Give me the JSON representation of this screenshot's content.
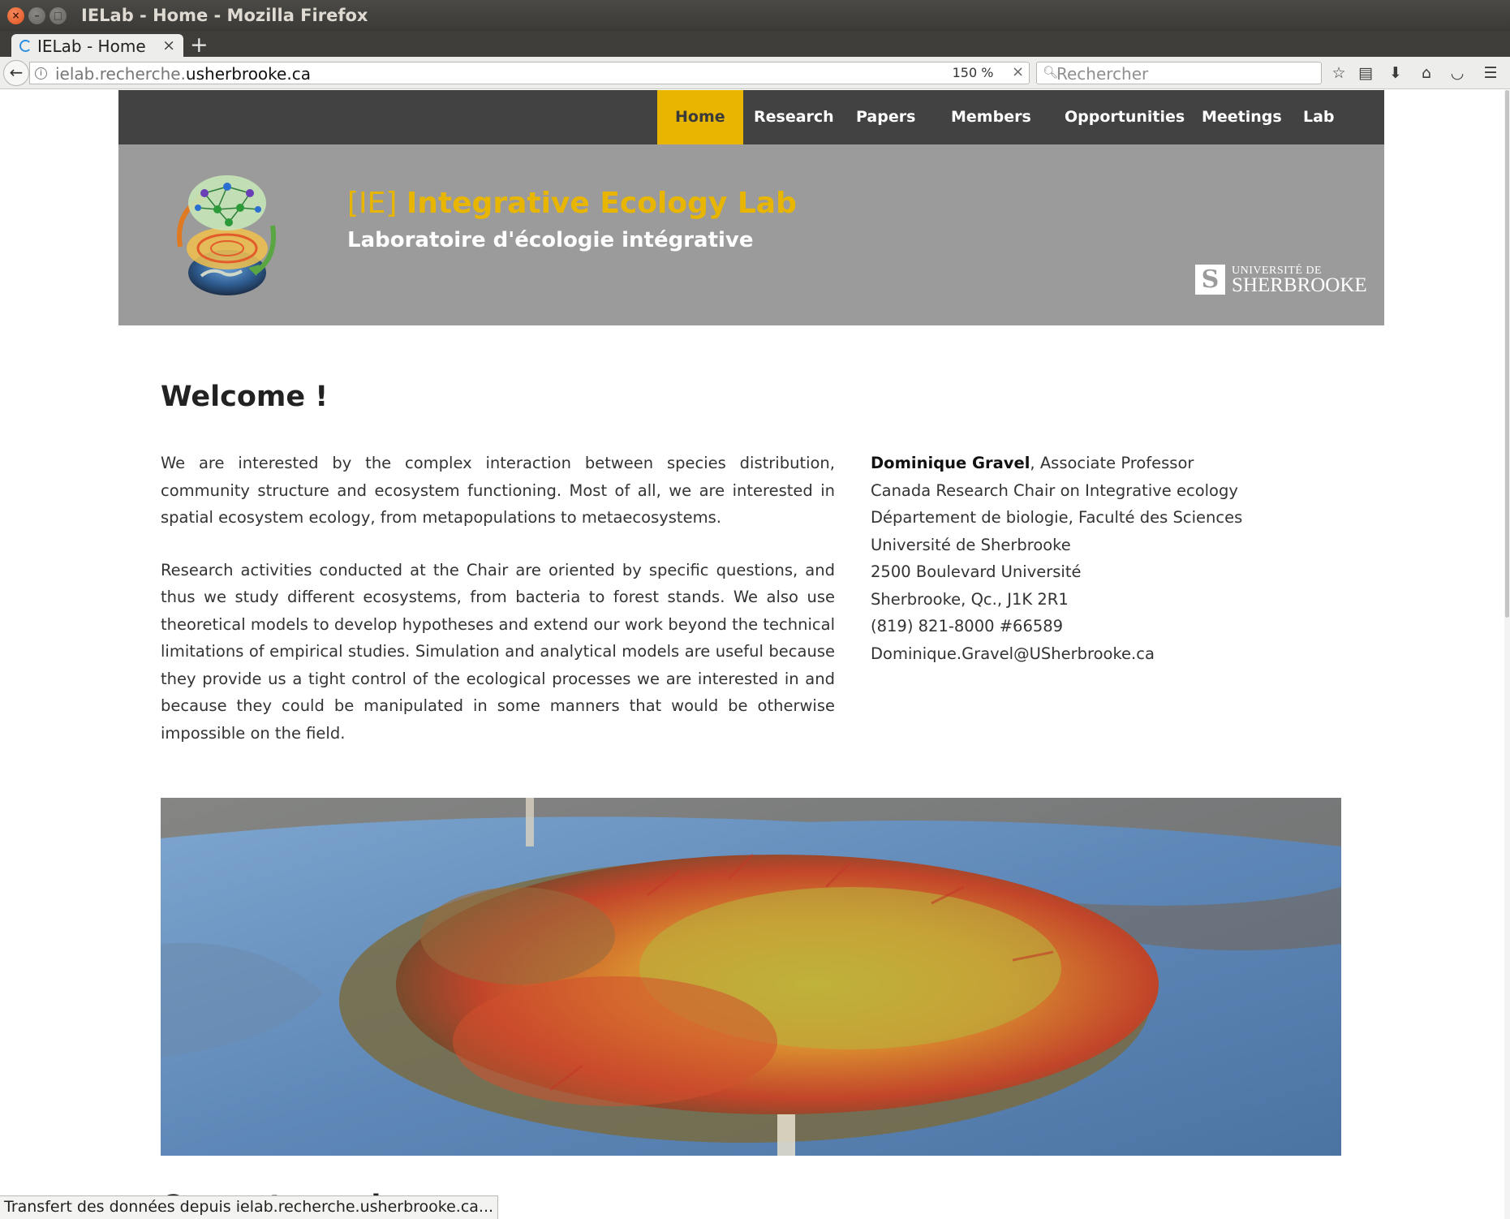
{
  "window": {
    "title": "IELab - Home - Mozilla Firefox"
  },
  "tabs": [
    {
      "label": "IELab - Home",
      "loading": true
    }
  ],
  "navbar": {
    "url_subdomain": "ielab.recherche.",
    "url_domain": "usherbrooke.ca",
    "zoom": "150 %",
    "search_placeholder": "Rechercher"
  },
  "site": {
    "nav": [
      {
        "label": "Home",
        "active": true
      },
      {
        "label": "Research"
      },
      {
        "label": "Papers"
      },
      {
        "label": "Members"
      },
      {
        "label": "Opportunities"
      },
      {
        "label": "Meetings"
      },
      {
        "label": "Lab spaces"
      }
    ],
    "banner": {
      "bracket": "[IE]",
      "name": "Integrative Ecology Lab",
      "subtitle": "Laboratoire d'écologie intégrative",
      "university_top": "UNIVERSITÉ DE",
      "university_main": "SHERBROOKE"
    },
    "welcome": "Welcome !",
    "intro": [
      "We are interested by the complex interaction between species distribution, community structure and ecosystem functioning. Most of all, we are interested in spatial ecosystem ecology, from metapopulations to metaecosystems.",
      "Research activities conducted at the Chair are oriented by specific questions, and thus we study different ecosystems, from bacteria to forest stands. We also use theoretical models to develop hypotheses and extend our work beyond the technical limitations of empirical studies. Simulation and analytical models are useful because they provide us a tight control of the ecological processes we are interested in and because they could be manipulated in some manners that would be otherwise impossible on the field."
    ],
    "contact": {
      "name": "Dominique Gravel",
      "role": ", Associate Professor",
      "lines": [
        "Canada Research Chair on Integrative ecology",
        "Département de biologie, Faculté des Sciences",
        "Université de Sherbrooke",
        "2500 Boulevard Université",
        "Sherbrooke, Qc., J1K 2R1",
        "(819) 821-8000 #66589",
        "Dominique.Gravel@USherbrooke.ca"
      ]
    },
    "next_heading": "Current members"
  },
  "status": "Transfert des données depuis ielab.recherche.usherbrooke.ca...",
  "colors": {
    "accent": "#e8b600",
    "nav_bg": "#424242",
    "banner_bg": "#9b9b9b"
  }
}
